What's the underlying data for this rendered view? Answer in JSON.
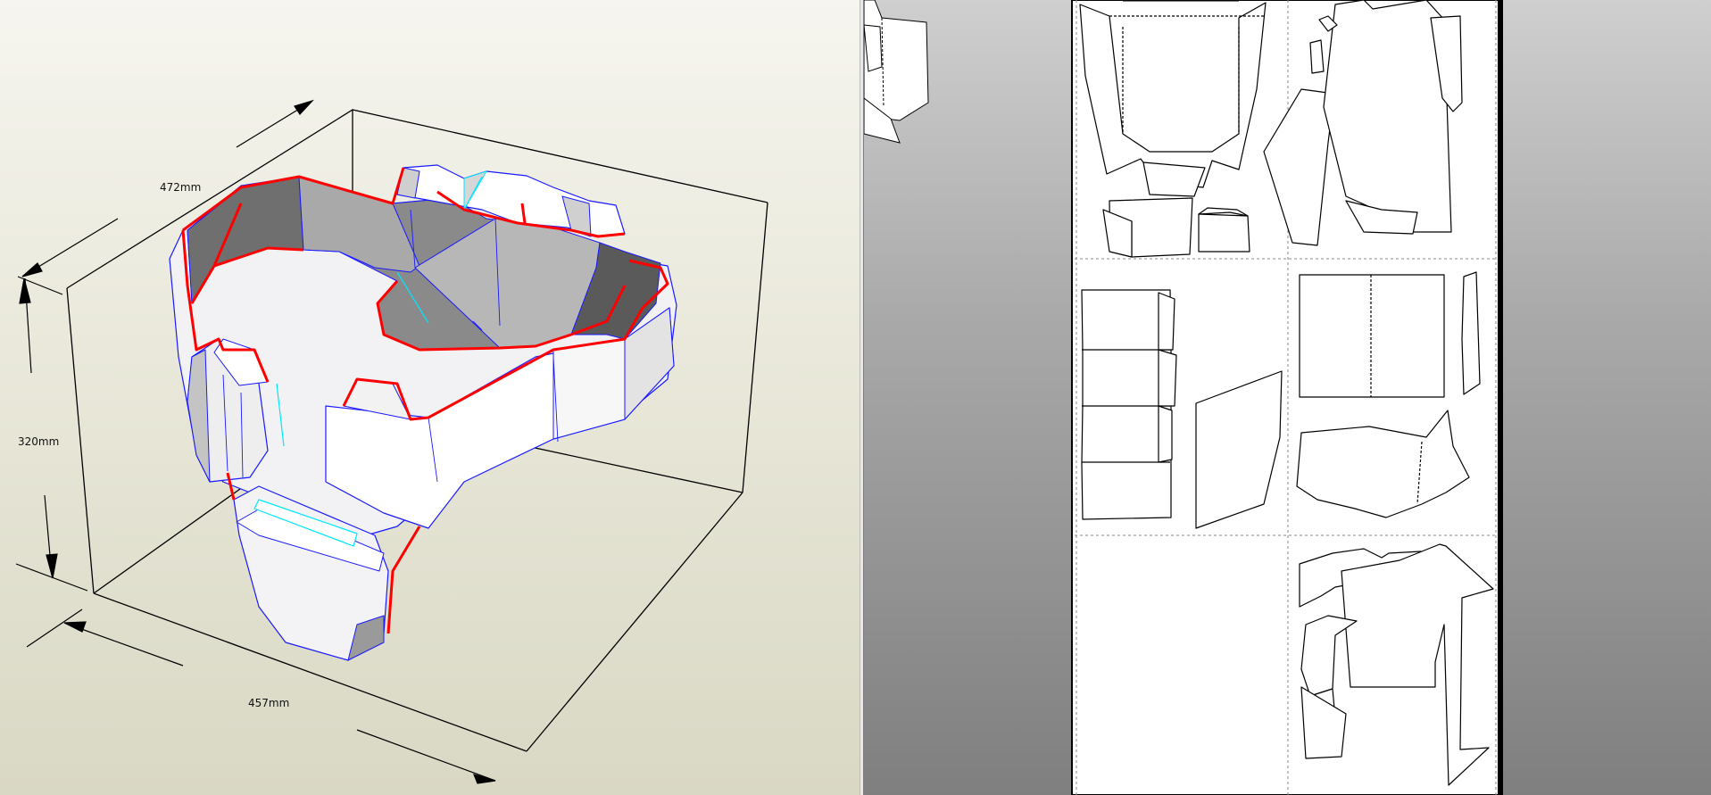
{
  "model_view": {
    "dimensions": {
      "width": "472mm",
      "height": "320mm",
      "depth": "457mm"
    }
  },
  "unfold_view": {
    "page_grid": {
      "columns": 2,
      "rows": 3
    },
    "colors": {
      "page_background": "#ffffff",
      "workspace_background": "#9a9a9a",
      "cut_line": "#000000",
      "fold_line": "#555555"
    }
  },
  "colors": {
    "model_edge": "#1a1aff",
    "model_seam": "#ff0000",
    "model_flap": "#00e5ff",
    "bounding_box": "#000000"
  }
}
